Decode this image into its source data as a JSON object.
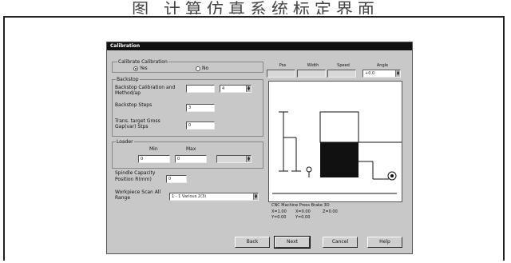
{
  "page_heading": "图 计算仿真系统标定界面",
  "dialog": {
    "title": "Calibration",
    "calibrate": {
      "group_label": "Calibrate Calibration",
      "options": [
        "Yes",
        "No"
      ],
      "selected": "Yes"
    },
    "backstop": {
      "label": "Backstop",
      "calibration_label": "Backstop Calibration and Method/ap",
      "calibration_value": "",
      "method_value": "4",
      "steps_label": "Backstop Steps",
      "steps_value": "3",
      "start_gap_label": "Trans. target Gross Gap(var) Stps",
      "start_gap_value": "0"
    },
    "loader": {
      "label": "Loader",
      "col1_header": "Min",
      "col2_header": "Max",
      "min_value": "0",
      "max_value": "0",
      "extra_value": ""
    },
    "spindle": {
      "label": "Spindle Capacity",
      "capacity_label": "Position R(mm)",
      "capacity_value": "0"
    },
    "workpiece": {
      "label": "Workpiece Scan All Range",
      "value": "1 - 1 Various 2(3)"
    },
    "columns": {
      "headers": [
        "Pos",
        "Width",
        "Speed",
        "Angle"
      ],
      "values": [
        "",
        "",
        "",
        "+0.0"
      ]
    },
    "preview_info": "CNC Machine Press Brake 3D",
    "readouts": [
      [
        "X=1.00",
        "X=0.00"
      ],
      [
        "Y=0.00",
        "Y=0.00"
      ],
      [
        "Z=0.00",
        ""
      ]
    ],
    "buttons": [
      "Back",
      "Next",
      "Cancel",
      "Help"
    ]
  }
}
